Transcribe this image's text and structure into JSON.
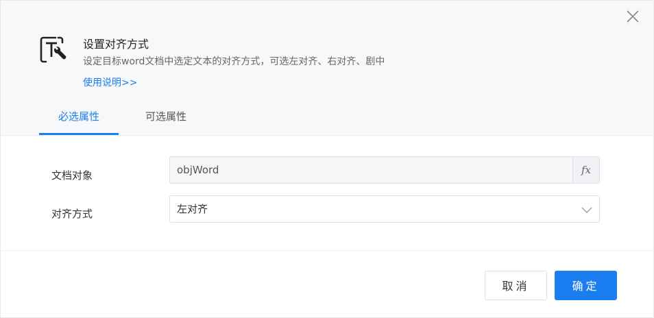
{
  "dialog": {
    "title": "设置对齐方式",
    "description": "设定目标word文档中选定文本的对齐方式，可选左对齐、右对齐、剧中",
    "help_link": "使用说明>>",
    "command_icon": "text-align-tool-icon",
    "close_icon": "close-icon"
  },
  "tabs": [
    {
      "label": "必选属性",
      "active": true
    },
    {
      "label": "可选属性",
      "active": false
    }
  ],
  "form": {
    "document": {
      "label": "文档对象",
      "value": "objWord",
      "fx_label": "fx"
    },
    "alignment": {
      "label": "对齐方式",
      "value": "左对齐",
      "arrow_icon": "chevron-down-icon"
    }
  },
  "footer": {
    "cancel_label": "取消",
    "ok_label": "确定"
  },
  "colors": {
    "accent": "#1a7df0",
    "header_bg": "#f7f8fa"
  }
}
